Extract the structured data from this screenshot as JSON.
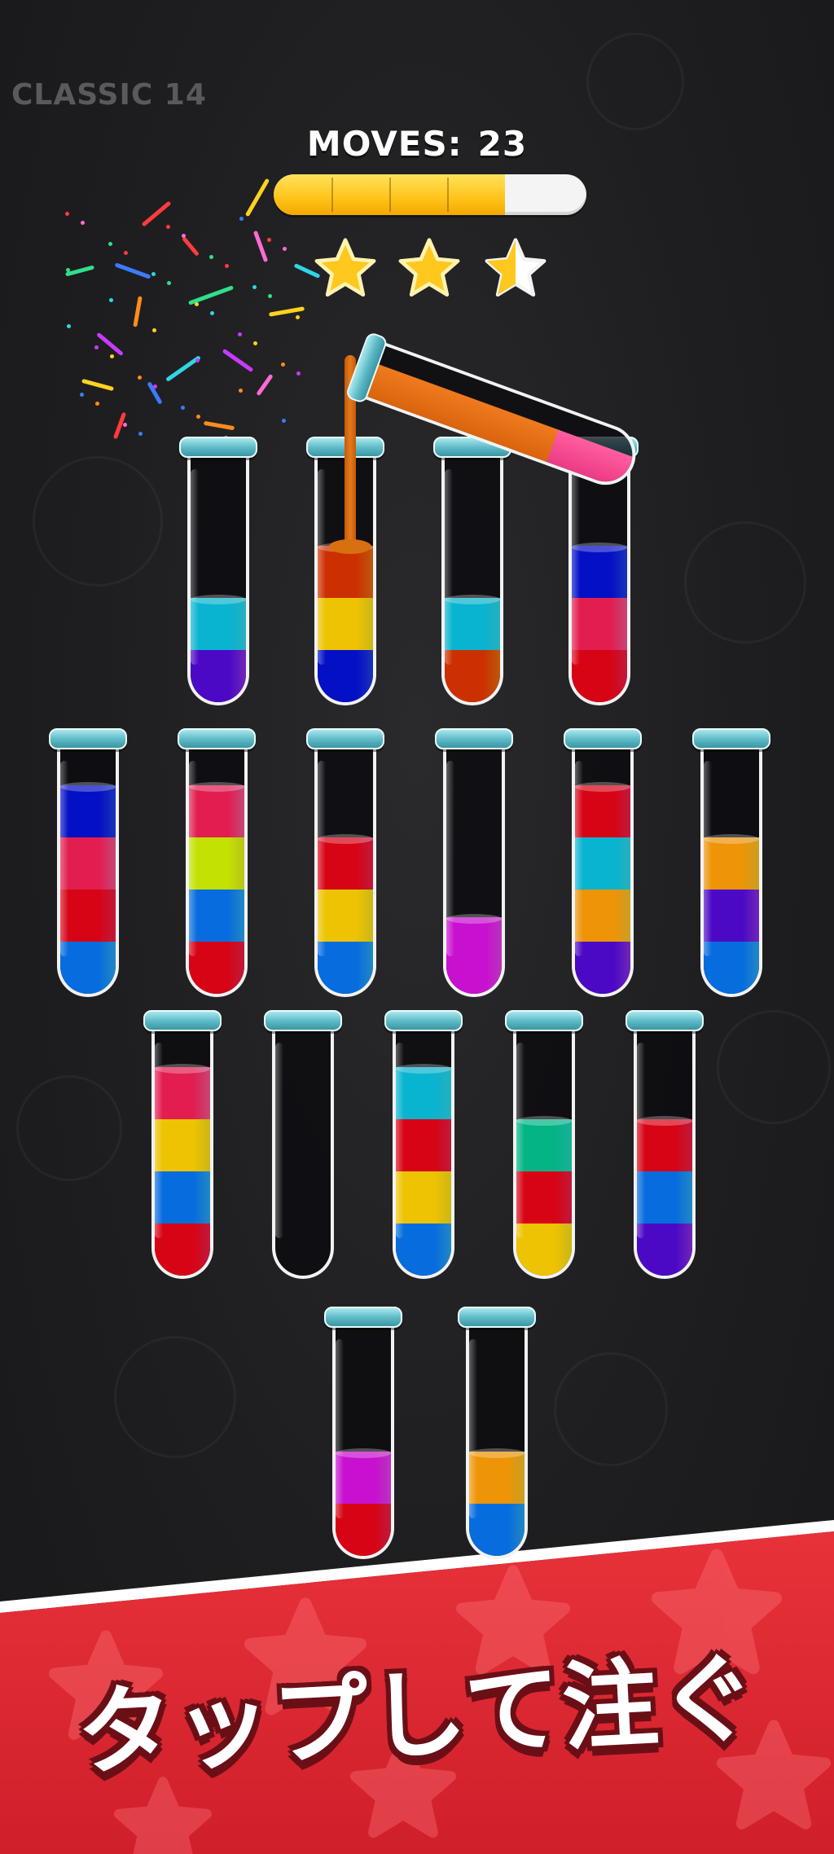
{
  "level": {
    "label": "CLASSIC 14"
  },
  "moves": {
    "label": "MOVES:",
    "value": "23"
  },
  "progress": {
    "fraction": 0.74,
    "segments": 4
  },
  "stars": {
    "total": 3,
    "filled": 2
  },
  "colors": {
    "cyan": "#2fd6e6",
    "purple": "#8a2fe0",
    "orange": "#e46e10",
    "yellow": "#f6df1b",
    "blue": "#1f3fe0",
    "pink": "#f0568f",
    "red": "#ea1f4a",
    "skyblue": "#2aa6ee",
    "magenta": "#e23fe6",
    "lime": "#dff01e",
    "gold": "#f6c22a",
    "teal": "#20d6b8",
    "progress_fill": "#ffc21a",
    "banner": "#e8323a",
    "tube_lip": "#5bb8c5"
  },
  "tubes": [
    {
      "id": "t1",
      "layers": [
        "purple",
        "cyan"
      ]
    },
    {
      "id": "t2",
      "layers": [
        "blue",
        "yellow",
        "orange"
      ]
    },
    {
      "id": "t3",
      "layers": [
        "orange",
        "cyan"
      ]
    },
    {
      "id": "t4",
      "layers": [
        "red",
        "pink",
        "blue"
      ]
    },
    {
      "id": "t5",
      "layers": [
        "skyblue",
        "red",
        "pink",
        "blue"
      ]
    },
    {
      "id": "t6",
      "layers": [
        "red",
        "skyblue",
        "lime",
        "pink"
      ]
    },
    {
      "id": "t7",
      "layers": [
        "skyblue",
        "yellow",
        "red"
      ]
    },
    {
      "id": "t8",
      "layers": [
        "magenta"
      ]
    },
    {
      "id": "t9",
      "layers": [
        "purple",
        "gold",
        "cyan",
        "red"
      ]
    },
    {
      "id": "t10",
      "layers": [
        "skyblue",
        "purple",
        "gold"
      ]
    },
    {
      "id": "t11",
      "layers": [
        "red",
        "skyblue",
        "yellow",
        "pink"
      ]
    },
    {
      "id": "t12",
      "layers": []
    },
    {
      "id": "t13",
      "layers": [
        "skyblue",
        "yellow",
        "red",
        "cyan"
      ]
    },
    {
      "id": "t14",
      "layers": [
        "yellow",
        "red",
        "teal"
      ]
    },
    {
      "id": "t15",
      "layers": [
        "purple",
        "skyblue",
        "red"
      ]
    },
    {
      "id": "t16",
      "layers": [
        "red",
        "magenta"
      ]
    },
    {
      "id": "t17",
      "layers": [
        "skyblue",
        "gold"
      ]
    }
  ],
  "pouring_tube": {
    "layers": [
      "orange",
      "pink"
    ]
  },
  "banner": {
    "text": "タップして注ぐ"
  }
}
